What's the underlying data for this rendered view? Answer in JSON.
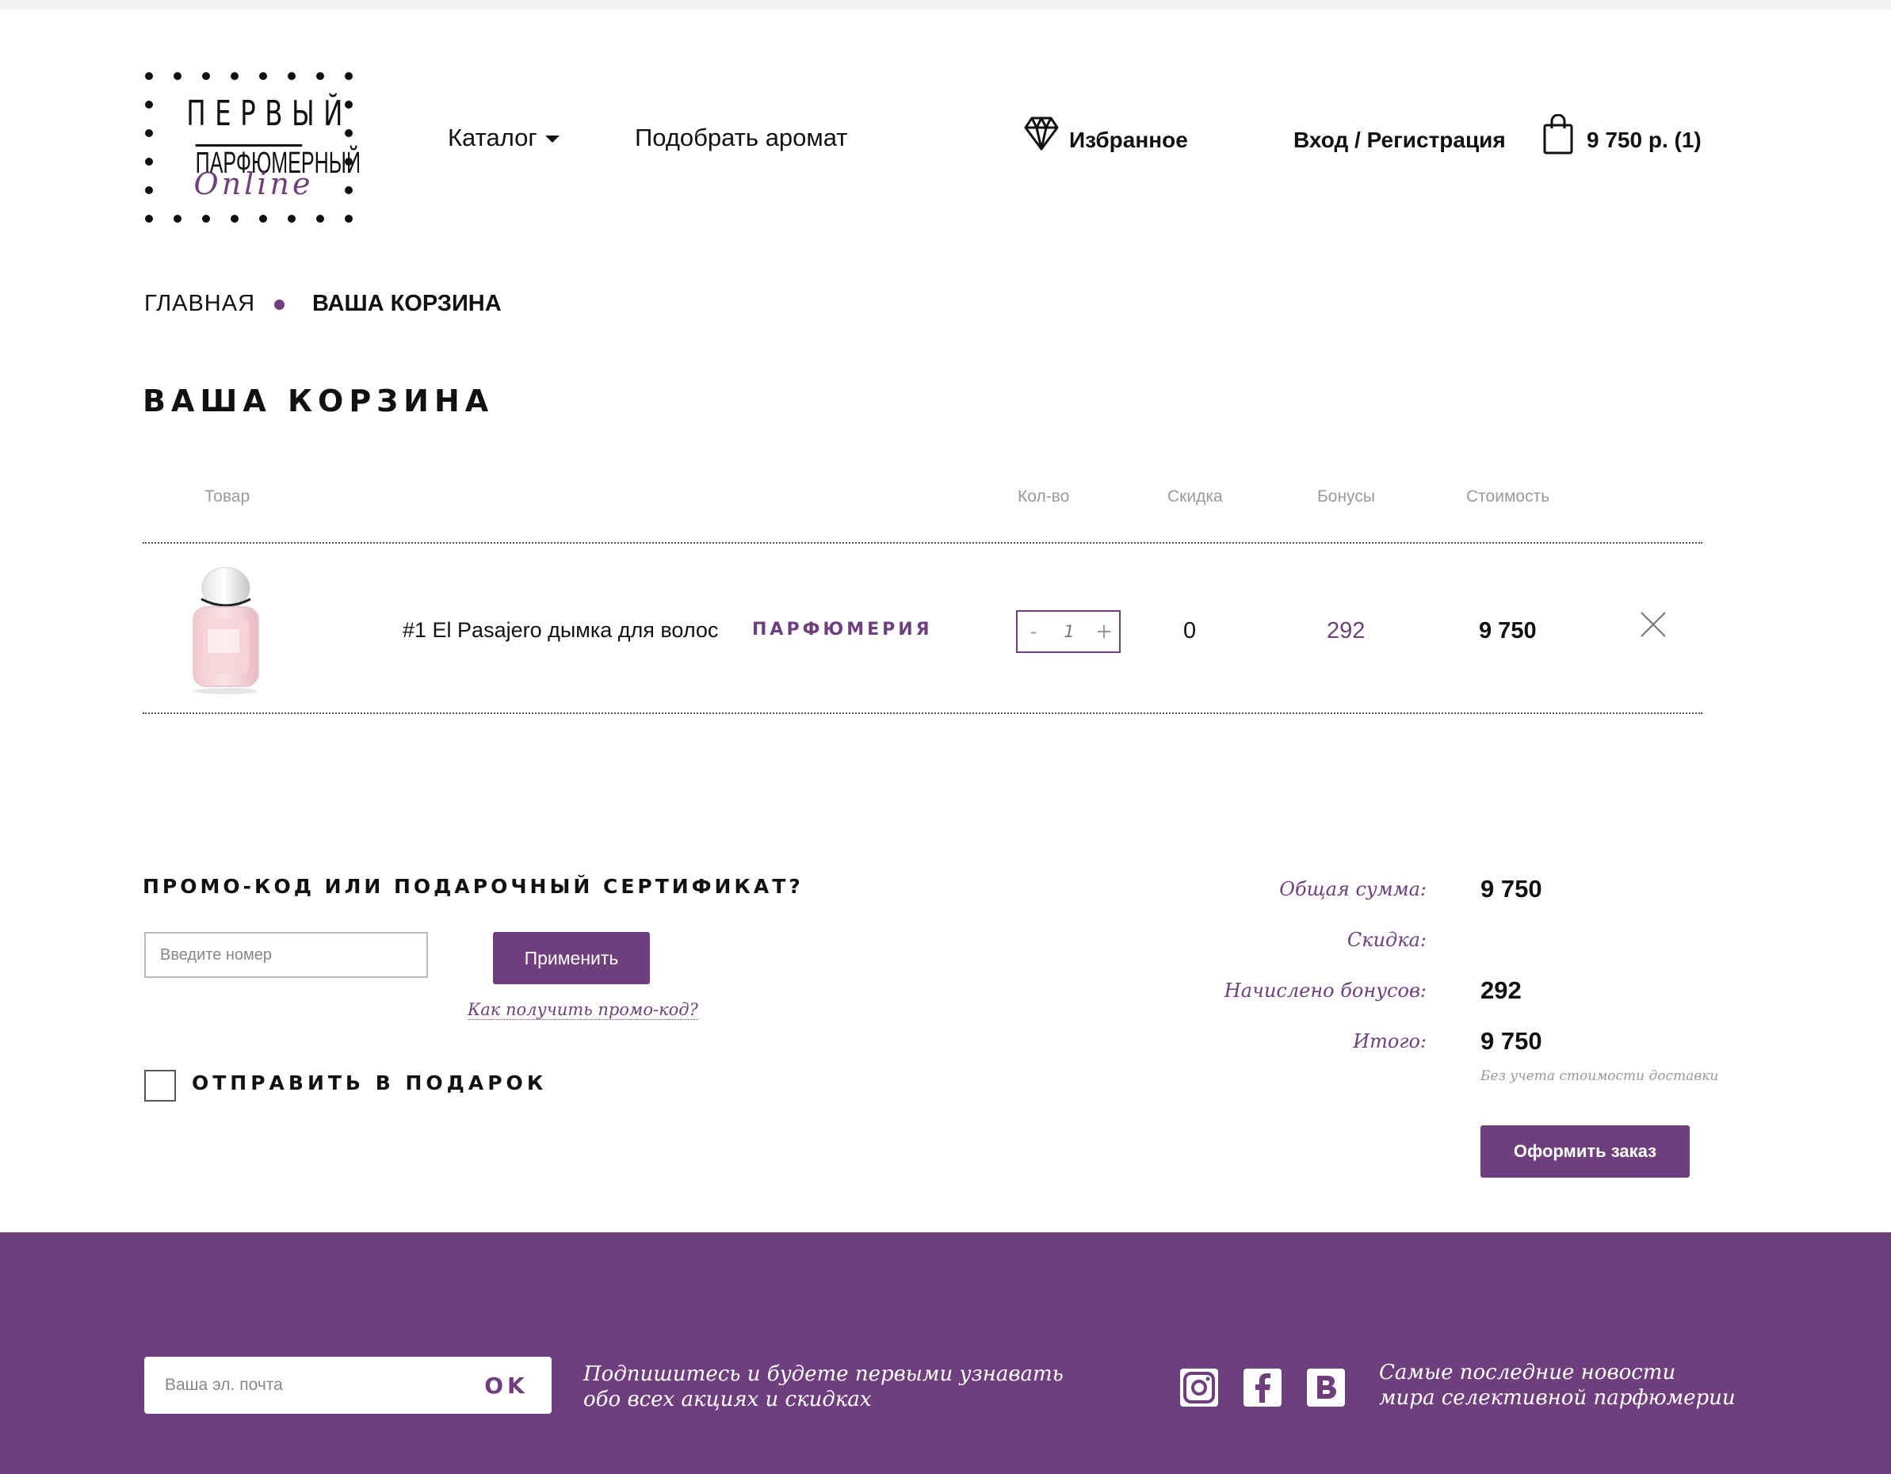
{
  "brand": {
    "logo_line1": "ПЕРВЫЙ",
    "logo_line2": "ПАРФЮМЕРНЫЙ",
    "logo_line3": "Online",
    "accent_color": "#6e3f7c"
  },
  "nav": {
    "catalog": "Каталог",
    "pick_aroma": "Подобрать аромат",
    "favorites": "Избранное",
    "login": "Вход / Регистрация",
    "cart_total": "9 750 р.",
    "cart_count": "(1)"
  },
  "breadcrumb": {
    "home": "ГЛАВНАЯ",
    "current": "ВАША КОРЗИНА"
  },
  "page_title": "ВАША КОРЗИНА",
  "table": {
    "headers": {
      "product": "Товар",
      "qty": "Кол-во",
      "discount": "Скидка",
      "bonuses": "Бонусы",
      "cost": "Стоимость"
    },
    "rows": [
      {
        "name": "#1 El Pasajero дымка для волос",
        "category": "ПАРФЮМЕРИЯ",
        "qty": "1",
        "qty_minus": "-",
        "qty_plus": "+",
        "discount": "0",
        "bonuses": "292",
        "cost": "9 750"
      }
    ]
  },
  "promo": {
    "title": "ПРОМО-КОД ИЛИ ПОДАРОЧНЫЙ СЕРТИФИКАТ?",
    "placeholder": "Введите номер",
    "apply": "Применить",
    "help_link": "Как получить промо-код?"
  },
  "gift": {
    "label": "ОТПРАВИТЬ В ПОДАРОК",
    "checked": false
  },
  "summary": {
    "total_label": "Общая сумма:",
    "total_value": "9 750",
    "discount_label": "Скидка:",
    "bonus_label": "Начислено бонусов:",
    "bonus_value": "292",
    "final_label": "Итого:",
    "final_value": "9 750",
    "note": "Без учета стоимости доставки",
    "checkout": "Оформить заказ"
  },
  "footer": {
    "email_placeholder": "Ваша эл. почта",
    "ok": "OK",
    "subscribe_text_1": "Подпишитесь и будете первыми узнавать",
    "subscribe_text_2": "обо всех акциях и скидках",
    "social_icons": [
      "instagram-icon",
      "facebook-icon",
      "vk-icon"
    ],
    "news_text_1": "Самые последние новости",
    "news_text_2": "мира селективной парфюмерии"
  }
}
